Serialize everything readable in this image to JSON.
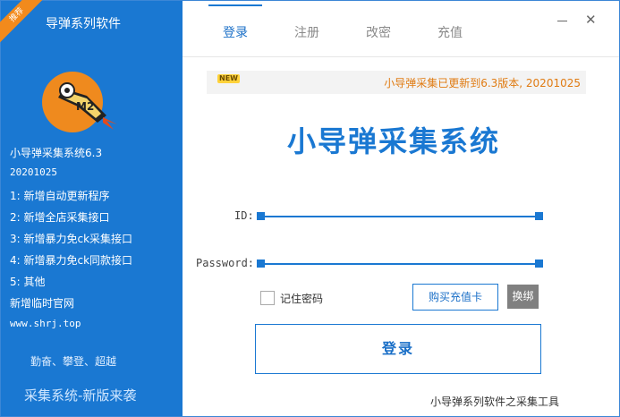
{
  "left_panel": {
    "ribbon": "推荐",
    "app_title": "导弹系列软件",
    "logo_text": "M2",
    "info_lines": [
      "小导弹采集系统6.3",
      "20201025",
      "1: 新增自动更新程序",
      "2: 新增全店采集接口",
      "3: 新增暴力免ck采集接口",
      "4: 新增暴力免ck同款接口",
      "5: 其他",
      "新增临时官网",
      "www.shrj.top"
    ],
    "slogan": "勤奋、攀登、超越",
    "bottom_slogan": "采集系统-新版来袭"
  },
  "tabs": [
    "登录",
    "注册",
    "改密",
    "充值"
  ],
  "active_tab": "登录",
  "notice": {
    "badge": "NEW",
    "text": "小导弹采集已更新到6.3版本, 20201025"
  },
  "main_title": "小导弹采集系统",
  "form": {
    "id_label": "ID:",
    "id_value": "",
    "password_label": "Password:",
    "password_value": "",
    "remember_label": "记住密码",
    "remember_checked": false,
    "buy_card_label": "购买充值卡",
    "swap_label": "换绑",
    "login_label": "登录"
  },
  "footer": "小导弹系列软件之采集工具",
  "colors": {
    "accent": "#1a78d2",
    "ribbon": "#f28a1c",
    "notice_text": "#e07b12",
    "swap_button": "#808080"
  },
  "icons": {
    "minimize": "minimize-icon",
    "close": "close-icon",
    "logo": "rocket-logo-icon"
  }
}
